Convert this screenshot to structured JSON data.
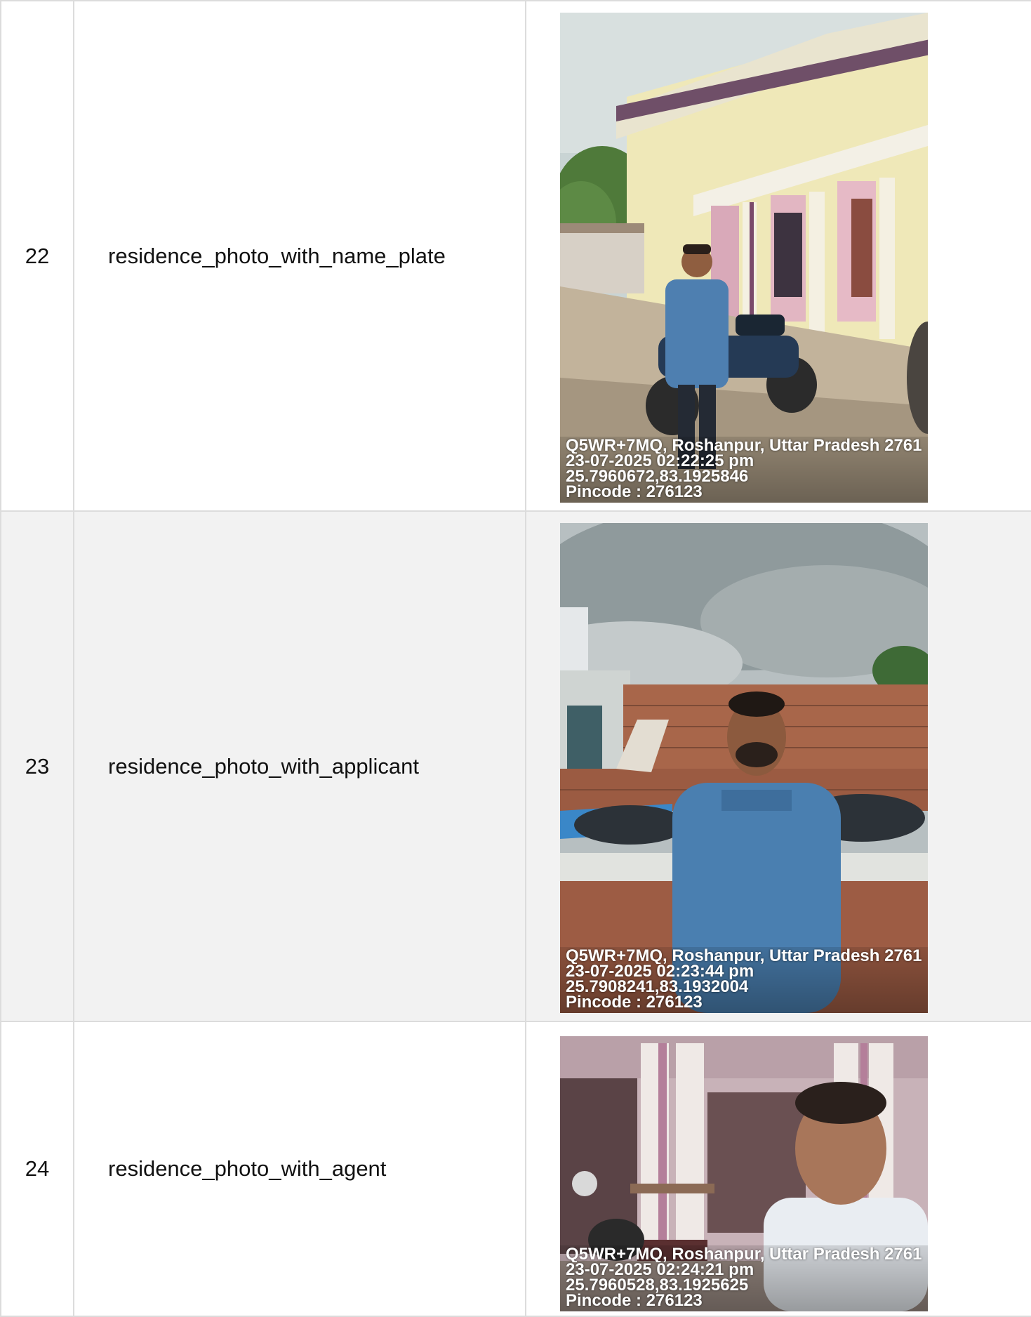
{
  "rows": [
    {
      "number": "22",
      "label": "residence_photo_with_name_plate",
      "photo": {
        "address": "Q5WR+7MQ, Roshanpur, Uttar Pradesh 2761",
        "datetime": "23-07-2025 02:22:25 pm",
        "coords": "25.7960672,83.1925846",
        "pincode": "Pincode : 276123"
      }
    },
    {
      "number": "23",
      "label": "residence_photo_with_applicant",
      "photo": {
        "address": "Q5WR+7MQ, Roshanpur, Uttar Pradesh 2761",
        "datetime": "23-07-2025 02:23:44 pm",
        "coords": "25.7908241,83.1932004",
        "pincode": "Pincode : 276123"
      }
    },
    {
      "number": "24",
      "label": "residence_photo_with_agent",
      "photo": {
        "address": "Q5WR+7MQ, Roshanpur, Uttar Pradesh 2761",
        "datetime": "23-07-2025 02:24:21 pm",
        "coords": "25.7960528,83.1925625",
        "pincode": "Pincode : 276123"
      }
    }
  ]
}
